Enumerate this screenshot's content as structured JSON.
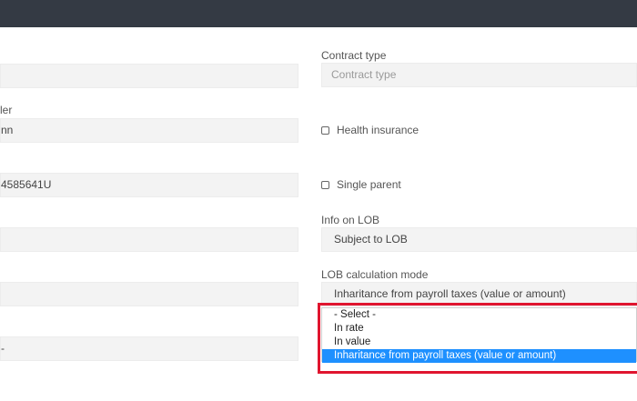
{
  "left_column": {
    "row2_label": "ler",
    "row2_value": "nn",
    "row3_value": "4585641U",
    "row7_value": "-"
  },
  "contract_type": {
    "label": "Contract type",
    "placeholder": "Contract type"
  },
  "health_insurance": {
    "label": "Health insurance",
    "checked": false
  },
  "single_parent": {
    "label": "Single parent",
    "checked": false
  },
  "info_on_lob": {
    "label": "Info on LOB",
    "value": "Subject to LOB"
  },
  "lob_calculation_mode": {
    "label": "LOB calculation mode",
    "value": "Inharitance from payroll taxes (value or amount)",
    "options": [
      "- Select -",
      "In rate",
      "In value",
      "Inharitance from payroll taxes (value or amount)"
    ],
    "selected_index": 3
  },
  "colors": {
    "topbar": "#343a44",
    "field_bg": "#f3f3f3",
    "selected_option": "#1e90ff",
    "highlight": "#e0152f"
  }
}
